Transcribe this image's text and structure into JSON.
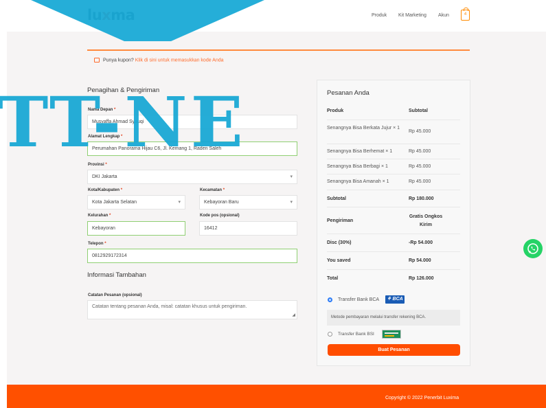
{
  "brand": {
    "logo_prefix": "lu",
    "logo_mark": "x",
    "logo_suffix": "ma"
  },
  "nav": {
    "items": [
      "Produk",
      "Kit Marketing",
      "Akun"
    ],
    "cart_count": "4"
  },
  "watermark": "TT-NE",
  "coupon": {
    "prompt": "Punya kupon?",
    "link": "Klik di sini untuk memasukkan kode Anda"
  },
  "billing": {
    "title": "Penagihan & Pengiriman",
    "first_name": {
      "label": "Nama Depan",
      "value": "Musyaffa Ahmad Syauqi"
    },
    "address": {
      "label": "Alamat Lengkap",
      "value": "Perumahan Panorama Hijau C6, Jl. Kemang 1, Raden Saleh"
    },
    "province": {
      "label": "Provinsi",
      "value": "DKI Jakarta"
    },
    "city": {
      "label": "Kota/Kabupaten",
      "value": "Kota Jakarta Selatan"
    },
    "district": {
      "label": "Kecamatan",
      "value": "Kebayoran Baru"
    },
    "village": {
      "label": "Kelurahan",
      "value": "Kebayoran"
    },
    "postcode": {
      "label": "Kode pos (opsional)",
      "value": "16412"
    },
    "phone": {
      "label": "Telepon",
      "value": "0812929172314"
    },
    "required_mark": "*"
  },
  "additional": {
    "title": "Informasi Tambahan",
    "notes_label": "Catatan Pesanan (opsional)",
    "notes_placeholder": "Catatan tentang pesanan Anda, misal: catatan khusus untuk pengiriman."
  },
  "order": {
    "title": "Pesanan Anda",
    "col_product": "Produk",
    "col_subtotal": "Subtotal",
    "items": [
      {
        "name": "Senangnya Bisa Berkata Jujur",
        "qty": "× 1",
        "price": "Rp 45.000"
      },
      {
        "name": "Senangnya Bisa Berhemat",
        "qty": "× 1",
        "price": "Rp 45.000"
      },
      {
        "name": "Senangnya Bisa Berbagi",
        "qty": "× 1",
        "price": "Rp 45.000"
      },
      {
        "name": "Senangnya Bisa Amanah",
        "qty": "× 1",
        "price": "Rp 45.000"
      }
    ],
    "subtotal_label": "Subtotal",
    "subtotal": "Rp 180.000",
    "shipping_label": "Pengiriman",
    "shipping": "Gratis Ongkos Kirim",
    "discount_label": "Disc (30%)",
    "discount": "-Rp 54.000",
    "saved_label": "You saved",
    "saved": "Rp 54.000",
    "total_label": "Total",
    "total": "Rp 126.000"
  },
  "payment": {
    "bca_label": "Transfer Bank BCA",
    "bca_logo": "BCA",
    "bca_desc": "Metode pembayaran melalui transfer rekening BCA.",
    "bsi_label": "Transfer Bank BSI",
    "submit": "Buat Pesanan"
  },
  "footer": {
    "copyright": "Copyright © 2022 Penerbit Luxima"
  },
  "colors": {
    "accent": "#ff5000",
    "watermark": "#1aa9d5",
    "valid": "#8fcf72",
    "whatsapp": "#25d366"
  }
}
